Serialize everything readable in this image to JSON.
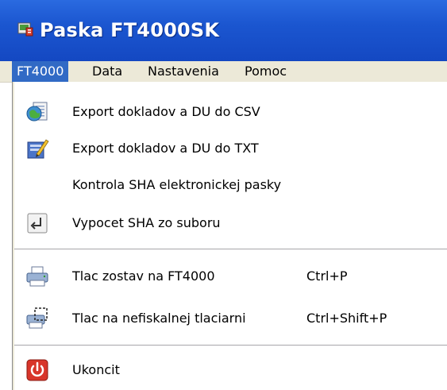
{
  "window": {
    "title": "Paska FT4000SK",
    "title_icon": "app-icon"
  },
  "menubar": {
    "items": [
      {
        "label": "FT4000",
        "active": true
      },
      {
        "label": "Data"
      },
      {
        "label": "Nastavenia"
      },
      {
        "label": "Pomoc"
      }
    ]
  },
  "menu": {
    "items": [
      {
        "label": "Export dokladov a DU do CSV",
        "icon": "csv-export-icon"
      },
      {
        "label": "Export dokladov a DU do TXT",
        "icon": "txt-export-icon"
      },
      {
        "label": "Kontrola SHA elektronickej pasky"
      },
      {
        "label": "Vypocet SHA zo suboru",
        "icon": "enter-arrow-icon"
      },
      {
        "label": "Tlac zostav na FT4000",
        "shortcut": "Ctrl+P",
        "icon": "printer-icon"
      },
      {
        "label": "Tlac na nefiskalnej tlaciarni",
        "shortcut": "Ctrl+Shift+P",
        "icon": "printer-preview-icon"
      },
      {
        "label": "Ukoncit",
        "icon": "power-off-icon"
      }
    ]
  },
  "colors": {
    "titlebar": "#1b56d0",
    "menubar": "#ece9d8",
    "menu_highlight": "#316ac5"
  }
}
